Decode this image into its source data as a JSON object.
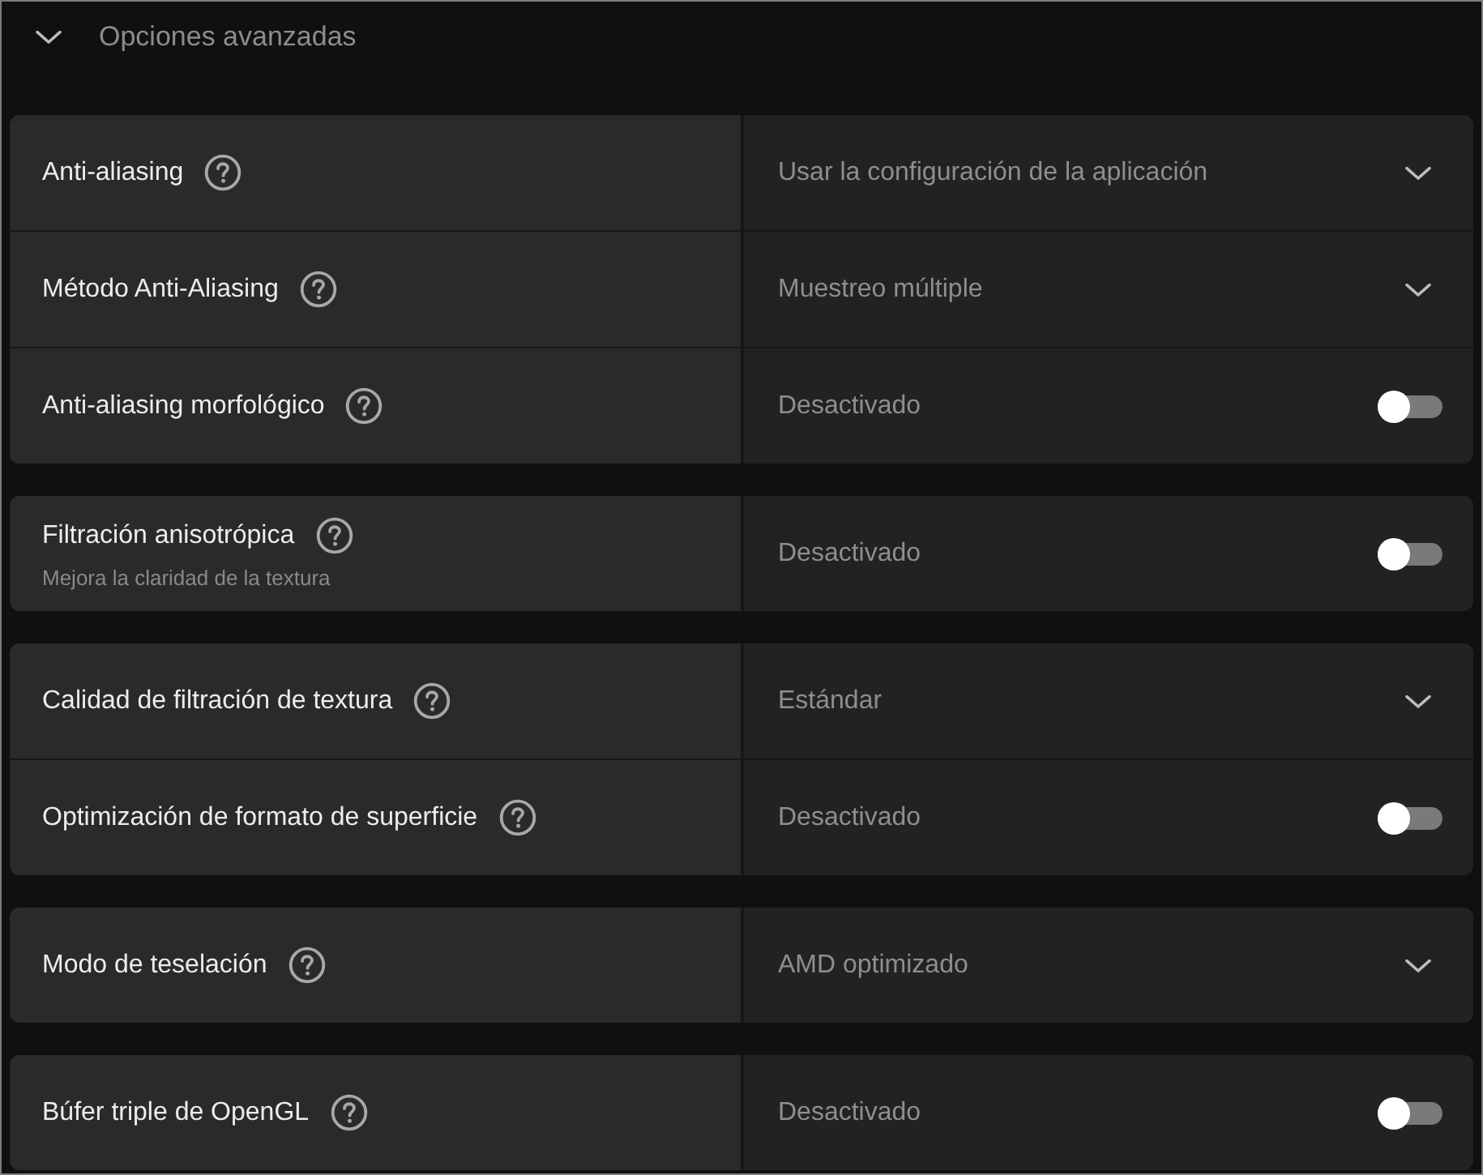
{
  "section": {
    "title": "Opciones avanzadas",
    "expanded": true
  },
  "groups": [
    {
      "settings": [
        {
          "kind": "dropdown",
          "label": "Anti-aliasing",
          "value": "Usar la configuración de la aplicación"
        },
        {
          "kind": "dropdown",
          "label": "Método Anti-Aliasing",
          "value": "Muestreo múltiple"
        },
        {
          "kind": "toggle",
          "label": "Anti-aliasing morfológico",
          "value": "Desactivado",
          "on": false
        }
      ]
    },
    {
      "settings": [
        {
          "kind": "toggle",
          "label": "Filtración anisotrópica",
          "description": "Mejora la claridad de la textura",
          "value": "Desactivado",
          "on": false
        }
      ]
    },
    {
      "settings": [
        {
          "kind": "dropdown",
          "label": "Calidad de filtración de textura",
          "value": "Estándar"
        },
        {
          "kind": "toggle",
          "label": "Optimización de formato de superficie",
          "value": "Desactivado",
          "on": false
        }
      ]
    },
    {
      "settings": [
        {
          "kind": "dropdown",
          "label": "Modo de teselación",
          "value": "AMD optimizado"
        }
      ]
    },
    {
      "settings": [
        {
          "kind": "toggle",
          "label": "Búfer triple de OpenGL",
          "value": "Desactivado",
          "on": false
        }
      ]
    }
  ]
}
